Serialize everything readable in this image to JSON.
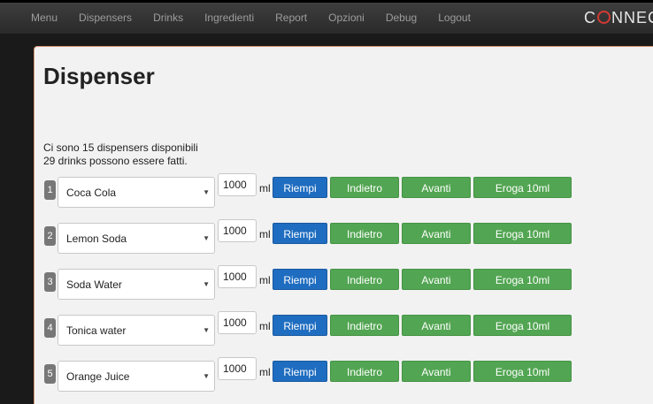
{
  "nav": {
    "items": [
      {
        "label": "Menu",
        "name": "nav-menu"
      },
      {
        "label": "Dispensers",
        "name": "nav-dispensers"
      },
      {
        "label": "Drinks",
        "name": "nav-drinks"
      },
      {
        "label": "Ingredienti",
        "name": "nav-ingredienti"
      },
      {
        "label": "Report",
        "name": "nav-report"
      },
      {
        "label": "Opzioni",
        "name": "nav-opzioni"
      },
      {
        "label": "Debug",
        "name": "nav-debug"
      },
      {
        "label": "Logout",
        "name": "nav-logout"
      }
    ],
    "logo_before": "C",
    "logo_after": "NNEC"
  },
  "page": {
    "title": "Dispenser",
    "info_line1": "Ci sono 15 dispensers disponibili",
    "info_line2": "29 drinks possono essere fatti."
  },
  "dispensers": [
    {
      "number": "1",
      "drink": "Coca Cola",
      "quantity": "1000"
    },
    {
      "number": "2",
      "drink": "Lemon Soda",
      "quantity": "1000"
    },
    {
      "number": "3",
      "drink": "Soda Water",
      "quantity": "1000"
    },
    {
      "number": "4",
      "drink": "Tonica water",
      "quantity": "1000"
    },
    {
      "number": "5",
      "drink": "Orange Juice",
      "quantity": "1000"
    }
  ],
  "labels": {
    "unit": "ml",
    "refill": "Riempi",
    "back": "Indietro",
    "forward": "Avanti",
    "dispense": "Eroga 10ml"
  },
  "colors": {
    "primary_button": "#1f6dc0",
    "success_button": "#52a552",
    "navbar": "#333333",
    "logo_accent": "#d23a32"
  }
}
